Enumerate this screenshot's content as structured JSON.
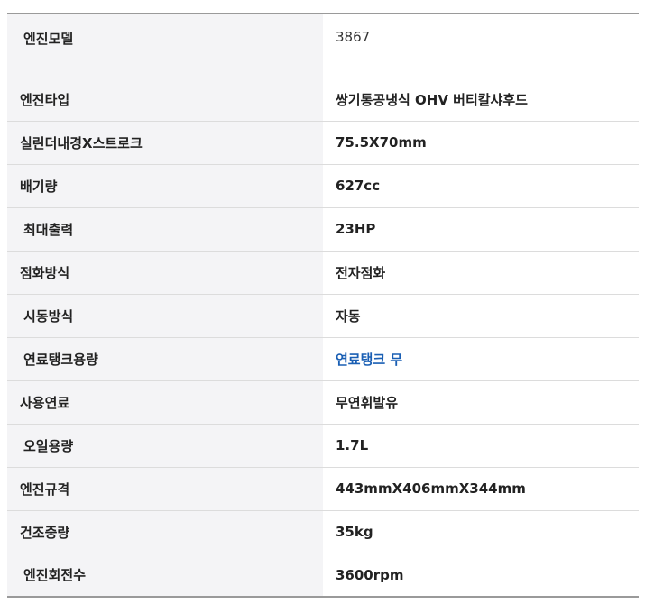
{
  "specs": [
    {
      "label": "엔진모델",
      "value": "3867"
    },
    {
      "label": "엔진타입",
      "value": "쌍기통공냉식 OHV 버티칼샤후드"
    },
    {
      "label": "실린더내경X스트로크",
      "value": "75.5X70mm"
    },
    {
      "label": "배기량",
      "value": "627cc"
    },
    {
      "label": "최대출력",
      "value": "23HP"
    },
    {
      "label": "점화방식",
      "value": "전자점화"
    },
    {
      "label": "시동방식",
      "value": "자동"
    },
    {
      "label": "연료탱크용량",
      "value": "연료탱크 무"
    },
    {
      "label": "사용연료",
      "value": "무연휘발유"
    },
    {
      "label": "오일용량",
      "value": "1.7L"
    },
    {
      "label": "엔진규격",
      "value": "443mmX406mmX344mm"
    },
    {
      "label": "건조중량",
      "value": "35kg"
    },
    {
      "label": "엔진회전수",
      "value": "3600rpm"
    }
  ],
  "colors": {
    "label_bg": "#f4f4f6",
    "border": "#dcdcdc",
    "link": "#1a5fb4"
  }
}
